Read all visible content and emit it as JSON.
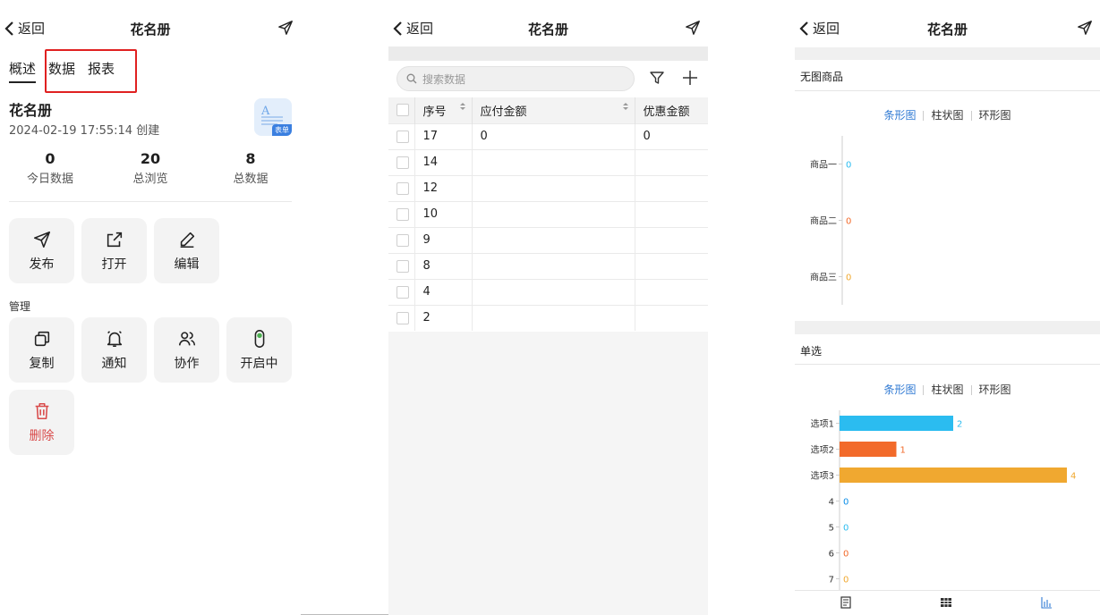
{
  "panel1": {
    "back_label": "返回",
    "title": "花名册",
    "tabs": [
      {
        "label": "概述",
        "active": true
      },
      {
        "label": "数据"
      },
      {
        "label": "报表"
      }
    ],
    "form_name": "花名册",
    "form_meta": "2024-02-19 17:55:14 创建",
    "form_badge": "表单",
    "stats": [
      {
        "value": "0",
        "label": "今日数据"
      },
      {
        "value": "20",
        "label": "总浏览"
      },
      {
        "value": "8",
        "label": "总数据"
      }
    ],
    "actions": [
      {
        "label": "发布",
        "icon": "send-icon"
      },
      {
        "label": "打开",
        "icon": "external-link-icon"
      },
      {
        "label": "编辑",
        "icon": "pencil-icon"
      }
    ],
    "manage_label": "管理",
    "manage": [
      {
        "label": "复制",
        "icon": "copy-icon"
      },
      {
        "label": "通知",
        "icon": "bell-icon"
      },
      {
        "label": "协作",
        "icon": "users-icon"
      },
      {
        "label": "开启中",
        "icon": "toggle-icon"
      },
      {
        "label": "删除",
        "icon": "trash-icon"
      }
    ]
  },
  "panel2": {
    "back_label": "返回",
    "title": "花名册",
    "search_placeholder": "搜索数据",
    "columns": [
      "序号",
      "应付金额",
      "优惠金额"
    ],
    "rows": [
      [
        "17",
        "0",
        "0"
      ],
      [
        "14",
        "",
        ""
      ],
      [
        "12",
        "",
        ""
      ],
      [
        "10",
        "",
        ""
      ],
      [
        "9",
        "",
        ""
      ],
      [
        "8",
        "",
        ""
      ],
      [
        "4",
        "",
        ""
      ],
      [
        "2",
        "",
        ""
      ]
    ]
  },
  "panel3": {
    "back_label": "返回",
    "title": "花名册",
    "chart_tabs": [
      "条形图",
      "柱状图",
      "环形图"
    ],
    "section1_title": "无图商品",
    "section2_title": "单选",
    "colors": [
      "#2bbcf0",
      "#f26a2a",
      "#f0a830",
      "#0b8ee8"
    ]
  },
  "chart_data": [
    {
      "type": "bar",
      "orientation": "horizontal",
      "title": "无图商品",
      "categories": [
        "商品一",
        "商品二",
        "商品三"
      ],
      "values": [
        0,
        0,
        0
      ]
    },
    {
      "type": "bar",
      "orientation": "horizontal",
      "title": "单选",
      "categories": [
        "选项1",
        "选项2",
        "选项3",
        "4",
        "5",
        "6",
        "7"
      ],
      "values": [
        2,
        1,
        4,
        0,
        0,
        0,
        0
      ],
      "xlim": [
        0,
        4
      ]
    }
  ]
}
